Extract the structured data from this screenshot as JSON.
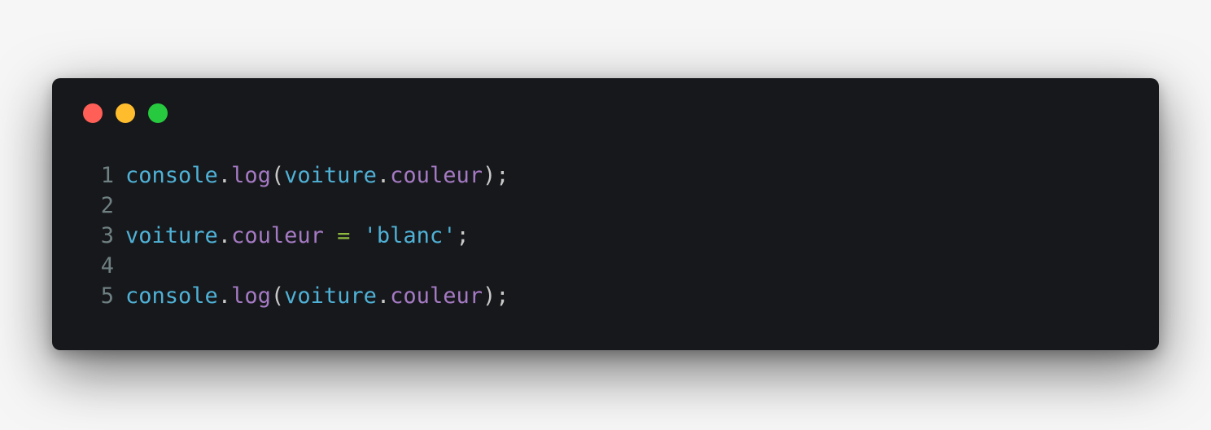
{
  "window": {
    "controls": [
      {
        "name": "close-button",
        "color": "#ff5f56"
      },
      {
        "name": "minimize-button",
        "color": "#ffbd2e"
      },
      {
        "name": "maximize-button",
        "color": "#27c93f"
      }
    ]
  },
  "code": {
    "lines": [
      {
        "number": "1",
        "tokens": [
          {
            "text": "console",
            "type": "ident"
          },
          {
            "text": ".",
            "type": "punct"
          },
          {
            "text": "log",
            "type": "prop"
          },
          {
            "text": "(",
            "type": "punct"
          },
          {
            "text": "voiture",
            "type": "ident"
          },
          {
            "text": ".",
            "type": "punct"
          },
          {
            "text": "couleur",
            "type": "prop"
          },
          {
            "text": ");",
            "type": "punct"
          }
        ]
      },
      {
        "number": "2",
        "tokens": []
      },
      {
        "number": "3",
        "tokens": [
          {
            "text": "voiture",
            "type": "ident"
          },
          {
            "text": ".",
            "type": "punct"
          },
          {
            "text": "couleur",
            "type": "prop"
          },
          {
            "text": " ",
            "type": "punct"
          },
          {
            "text": "=",
            "type": "op"
          },
          {
            "text": " ",
            "type": "punct"
          },
          {
            "text": "'blanc'",
            "type": "str"
          },
          {
            "text": ";",
            "type": "punct"
          }
        ]
      },
      {
        "number": "4",
        "tokens": []
      },
      {
        "number": "5",
        "tokens": [
          {
            "text": "console",
            "type": "ident"
          },
          {
            "text": ".",
            "type": "punct"
          },
          {
            "text": "log",
            "type": "prop"
          },
          {
            "text": "(",
            "type": "punct"
          },
          {
            "text": "voiture",
            "type": "ident"
          },
          {
            "text": ".",
            "type": "punct"
          },
          {
            "text": "couleur",
            "type": "prop"
          },
          {
            "text": ");",
            "type": "punct"
          }
        ]
      }
    ]
  }
}
